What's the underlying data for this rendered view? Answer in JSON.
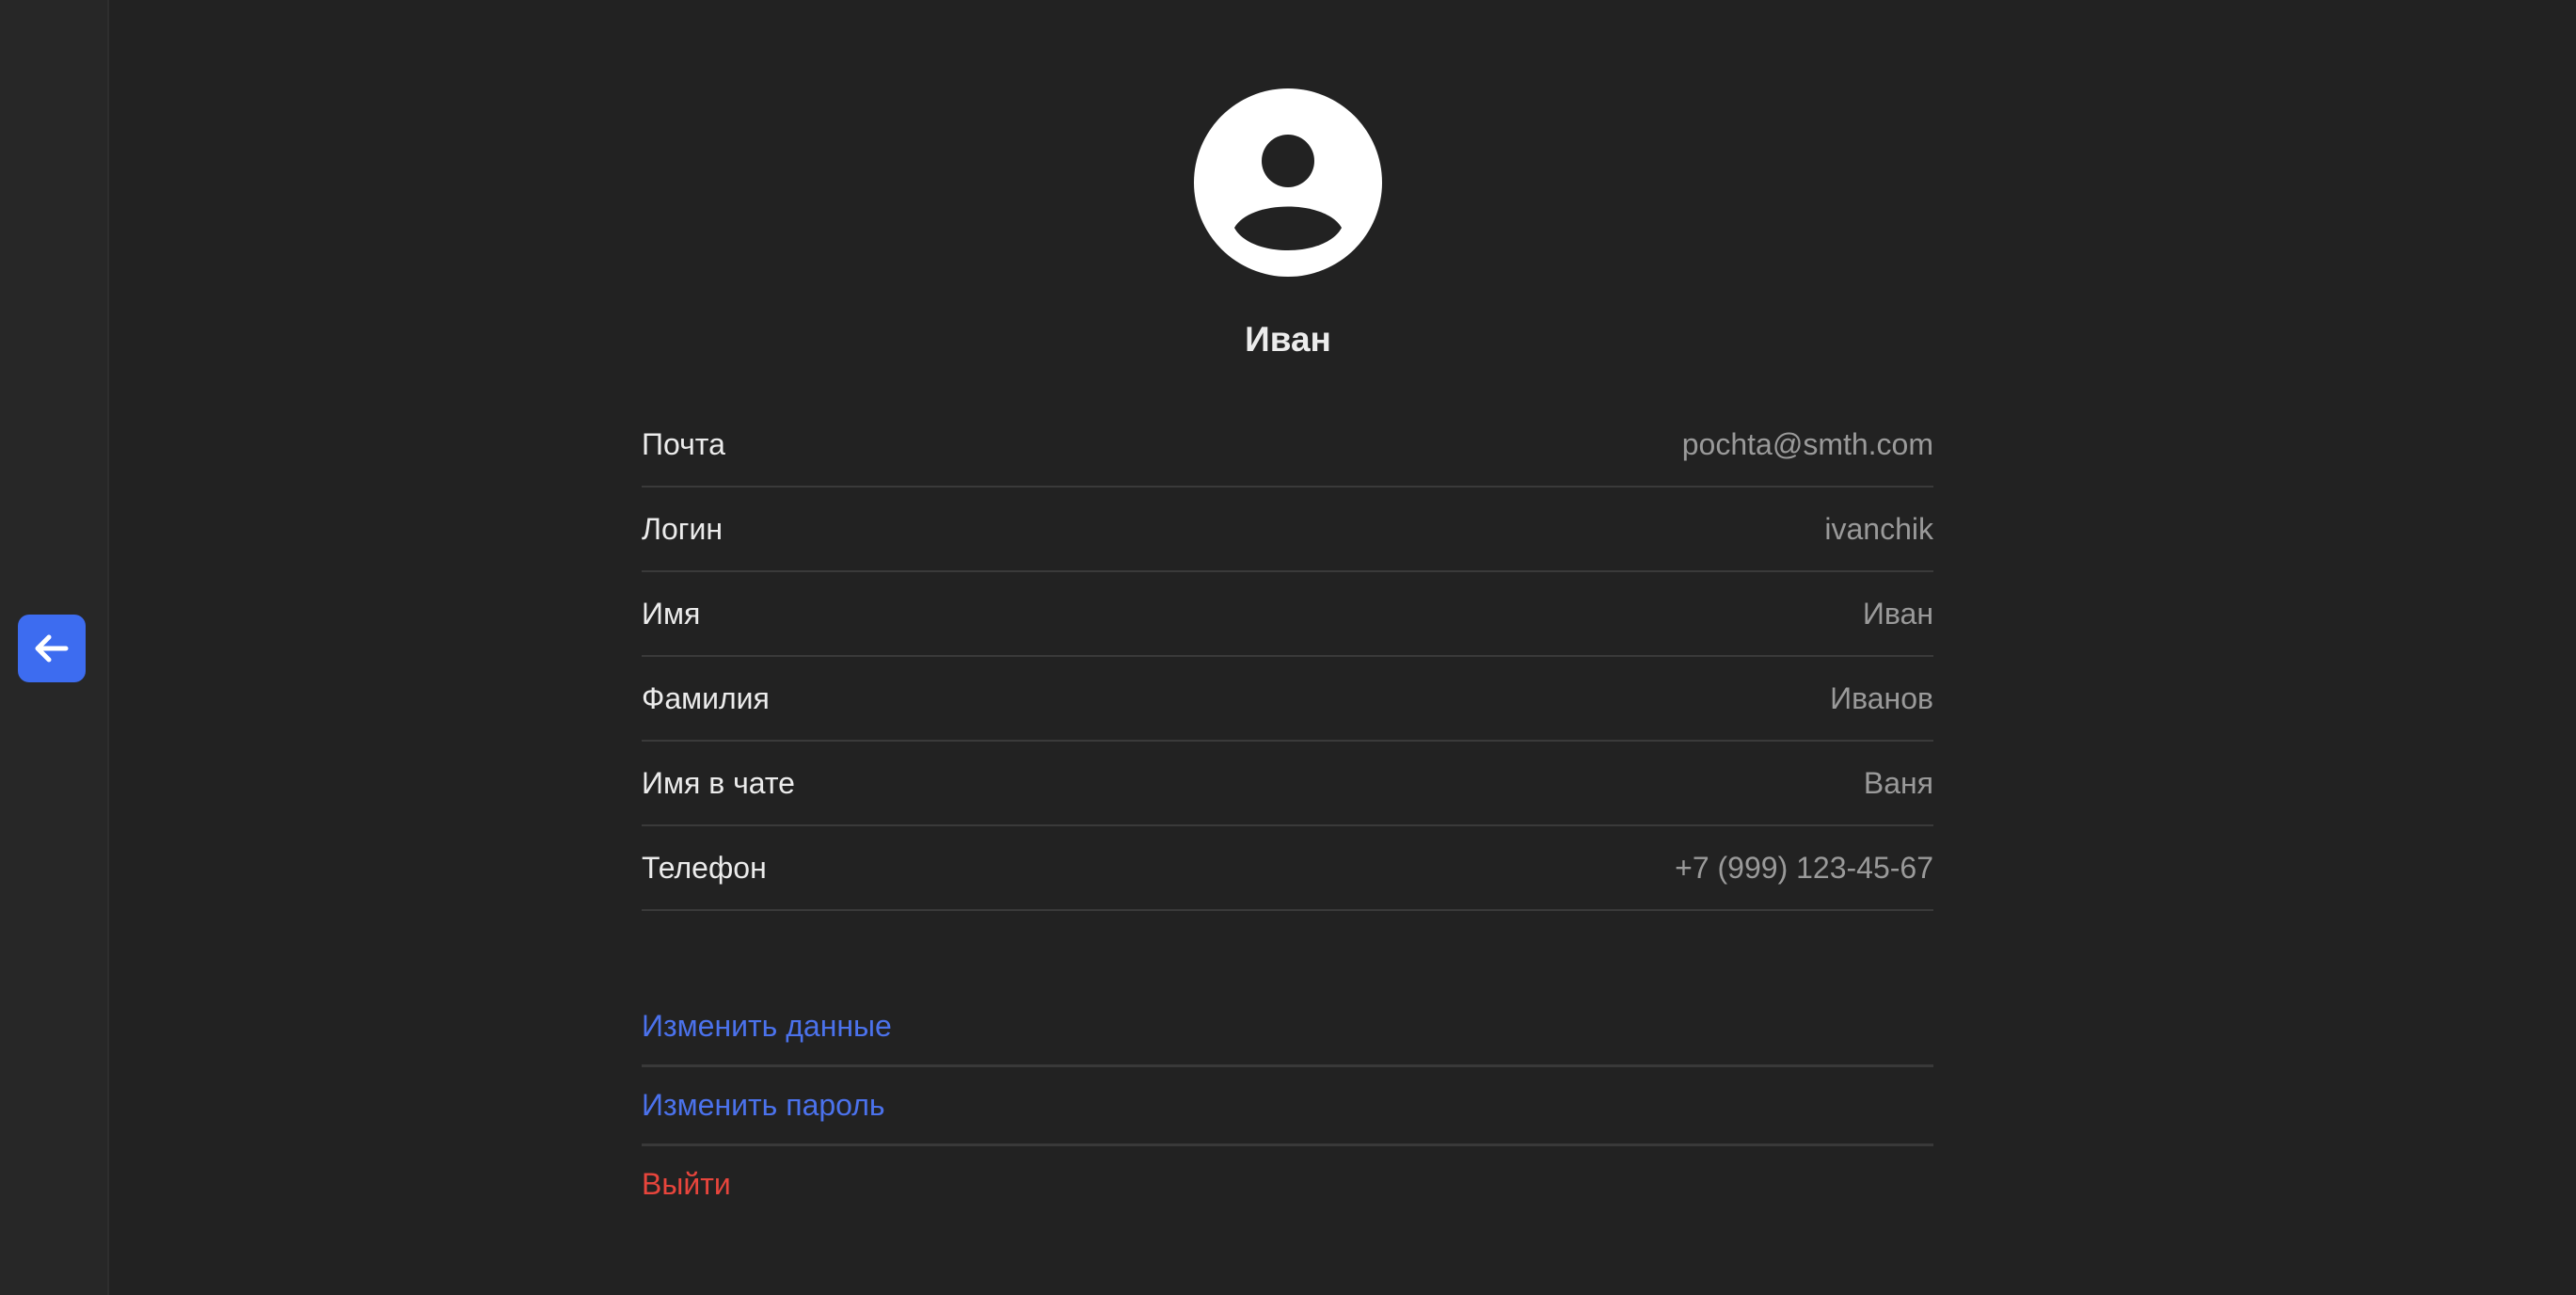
{
  "colors": {
    "background": "#222222",
    "sidebar": "#272727",
    "accent": "#3d6cf0",
    "link": "#4b72ec",
    "danger": "#e8453c",
    "label_text": "#ececec",
    "value_text": "#9a9a9a"
  },
  "sidebar": {
    "back_button_icon": "arrow-left-icon"
  },
  "profile": {
    "avatar_icon": "user-avatar-icon",
    "display_name": "Иван",
    "fields": [
      {
        "label": "Почта",
        "value": "pochta@smth.com"
      },
      {
        "label": "Логин",
        "value": "ivanchik"
      },
      {
        "label": "Имя",
        "value": "Иван"
      },
      {
        "label": "Фамилия",
        "value": "Иванов"
      },
      {
        "label": "Имя в чате",
        "value": "Ваня"
      },
      {
        "label": "Телефон",
        "value": "+7 (999) 123-45-67"
      }
    ]
  },
  "actions": {
    "edit_data": "Изменить данные",
    "edit_password": "Изменить пароль",
    "logout": "Выйти"
  }
}
